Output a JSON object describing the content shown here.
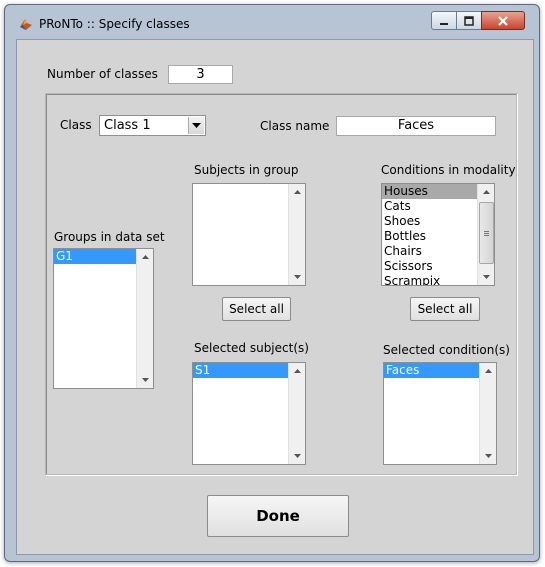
{
  "window": {
    "title": "PRoNTo :: Specify classes"
  },
  "num_classes": {
    "label": "Number of classes",
    "value": "3"
  },
  "class_select": {
    "label": "Class",
    "value": "Class 1"
  },
  "class_name": {
    "label": "Class name",
    "value": "Faces"
  },
  "subjects_in_group": {
    "label": "Subjects in group",
    "items": []
  },
  "conditions_in_modality": {
    "label": "Conditions in modality",
    "items": [
      "Houses",
      "Cats",
      "Shoes",
      "Bottles",
      "Chairs",
      "Scissors",
      "Scrampix"
    ]
  },
  "groups_in_data_set": {
    "label": "Groups in data set",
    "items": [
      "G1"
    ]
  },
  "buttons": {
    "select_all_subjects": "Select all",
    "select_all_conditions": "Select all",
    "done": "Done"
  },
  "selected_subjects": {
    "label": "Selected subject(s)",
    "items": [
      "S1"
    ]
  },
  "selected_conditions": {
    "label": "Selected condition(s)",
    "items": [
      "Faces"
    ]
  }
}
